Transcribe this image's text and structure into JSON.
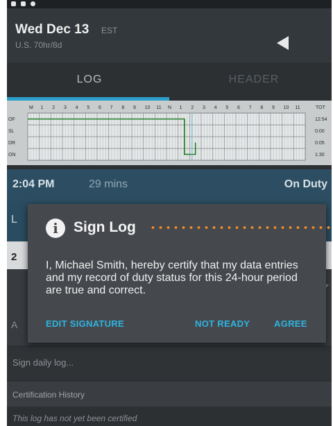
{
  "header": {
    "date": "Wed Dec 13",
    "timezone": "EST",
    "rule_set": "U.S. 70hr/8d"
  },
  "tabs": [
    {
      "label": "LOG",
      "active": true
    },
    {
      "label": "HEADER",
      "active": false
    }
  ],
  "graph": {
    "hours": [
      "M",
      "1",
      "2",
      "3",
      "4",
      "5",
      "6",
      "7",
      "8",
      "9",
      "10",
      "11",
      "N",
      "1",
      "2",
      "3",
      "4",
      "5",
      "6",
      "7",
      "8",
      "9",
      "10",
      "11"
    ],
    "total_label": "TOT",
    "rows": [
      {
        "label": "OF",
        "total": "12:54"
      },
      {
        "label": "SL",
        "total": "0:00"
      },
      {
        "label": "DR",
        "total": "0:05"
      },
      {
        "label": "ON",
        "total": "1:30"
      }
    ]
  },
  "current_status": {
    "time": "2:04 PM",
    "duration": "29 mins",
    "status": "On Duty"
  },
  "background_rows": {
    "edge_l": "L",
    "edge_2": "2",
    "edge_a": "A"
  },
  "dialog": {
    "title": "Sign Log",
    "body": "I, Michael Smith, hereby certify that my data entries and my record of duty status for this 24-hour period are true and correct.",
    "buttons": {
      "edit_signature": "EDIT SIGNATURE",
      "not_ready": "NOT READY",
      "agree": "AGREE"
    }
  },
  "sign_daily_log": "Sign daily log...",
  "certification": {
    "heading": "Certification History",
    "empty_text": "This log has not yet been certified"
  },
  "colors": {
    "accent": "#2fb3e0",
    "tab_indicator": "#2b9fc9",
    "status_bar_bg": "#2d4e62",
    "log_line": "#1f7a1f",
    "callout_dots": "#f08a2a"
  }
}
